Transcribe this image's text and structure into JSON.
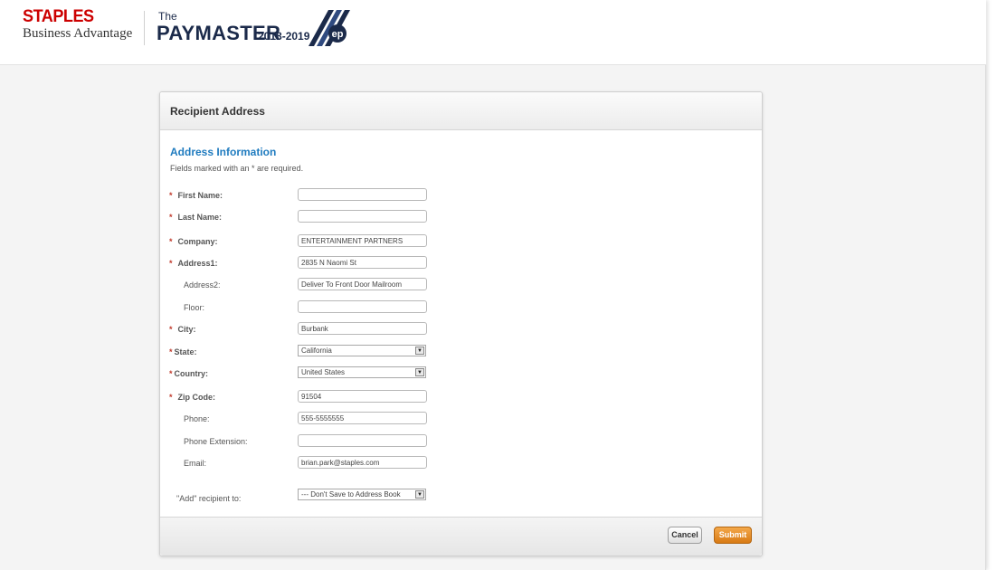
{
  "header": {
    "brand_name": "STAPLES",
    "brand_sub": "Business Advantage",
    "partner_the": "The",
    "partner_name": "PAYMASTER",
    "partner_years": "2018-2019",
    "partner_badge": "ep"
  },
  "panel": {
    "title": "Recipient Address",
    "section_title": "Address Information",
    "required_note": "Fields marked with an * are required."
  },
  "form": {
    "first_name": {
      "label": "First Name:",
      "value": ""
    },
    "last_name": {
      "label": "Last Name:",
      "value": ""
    },
    "company": {
      "label": "Company:",
      "value": "ENTERTAINMENT PARTNERS"
    },
    "address1": {
      "label": "Address1:",
      "value": "2835 N Naomi St"
    },
    "address2": {
      "label": "Address2:",
      "value": "Deliver To Front Door Mailroom"
    },
    "floor": {
      "label": "Floor:",
      "value": ""
    },
    "city": {
      "label": "City:",
      "value": "Burbank"
    },
    "state": {
      "label": "State:",
      "value": "California"
    },
    "country": {
      "label": "Country:",
      "value": "United States"
    },
    "zip": {
      "label": "Zip Code:",
      "value": "91504"
    },
    "phone": {
      "label": "Phone:",
      "value": "555-5555555"
    },
    "phone_ext": {
      "label": "Phone Extension:",
      "value": ""
    },
    "email": {
      "label": "Email:",
      "value": "brian.park@staples.com"
    },
    "add_recipient": {
      "label": "\"Add\" recipient to:",
      "value": "--- Don't Save to Address Book"
    },
    "required_star": "*"
  },
  "footer": {
    "cancel_label": "Cancel",
    "submit_label": "Submit"
  },
  "colors": {
    "brand_red": "#cc0000",
    "section_blue": "#1f7bbf",
    "submit_orange": "#e08a22",
    "required_red": "#c0392b",
    "paymaster_navy": "#1b2a4a"
  }
}
